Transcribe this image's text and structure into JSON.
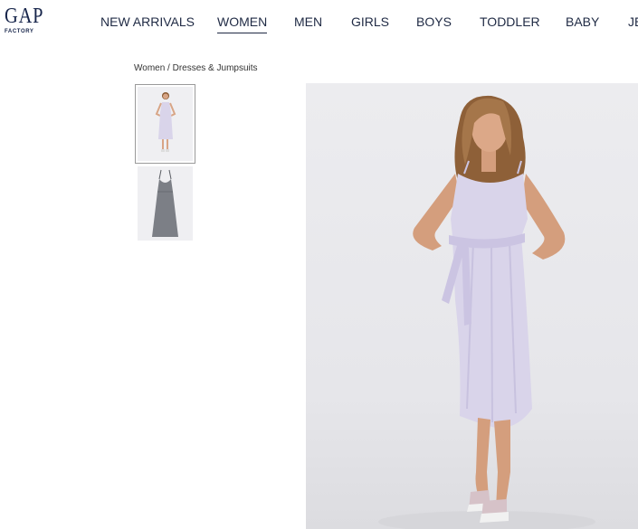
{
  "brand": {
    "logo_text": "GAP",
    "logo_subtext": "FACTORY"
  },
  "nav": {
    "items": [
      {
        "label": "NEW ARRIVALS",
        "active": false
      },
      {
        "label": "WOMEN",
        "active": true
      },
      {
        "label": "MEN",
        "active": false
      },
      {
        "label": "GIRLS",
        "active": false
      },
      {
        "label": "BOYS",
        "active": false
      },
      {
        "label": "TODDLER",
        "active": false
      },
      {
        "label": "BABY",
        "active": false
      },
      {
        "label": "JE",
        "active": false
      }
    ]
  },
  "breadcrumb": {
    "text": "Women / Dresses & Jumpsuits"
  },
  "product": {
    "thumbnails": [
      {
        "name": "model-front-view",
        "selected": true
      },
      {
        "name": "dress-flat-view",
        "selected": false
      }
    ],
    "dress_color": "#d9d4ea",
    "flat_dress_color": "#7c7f86"
  }
}
